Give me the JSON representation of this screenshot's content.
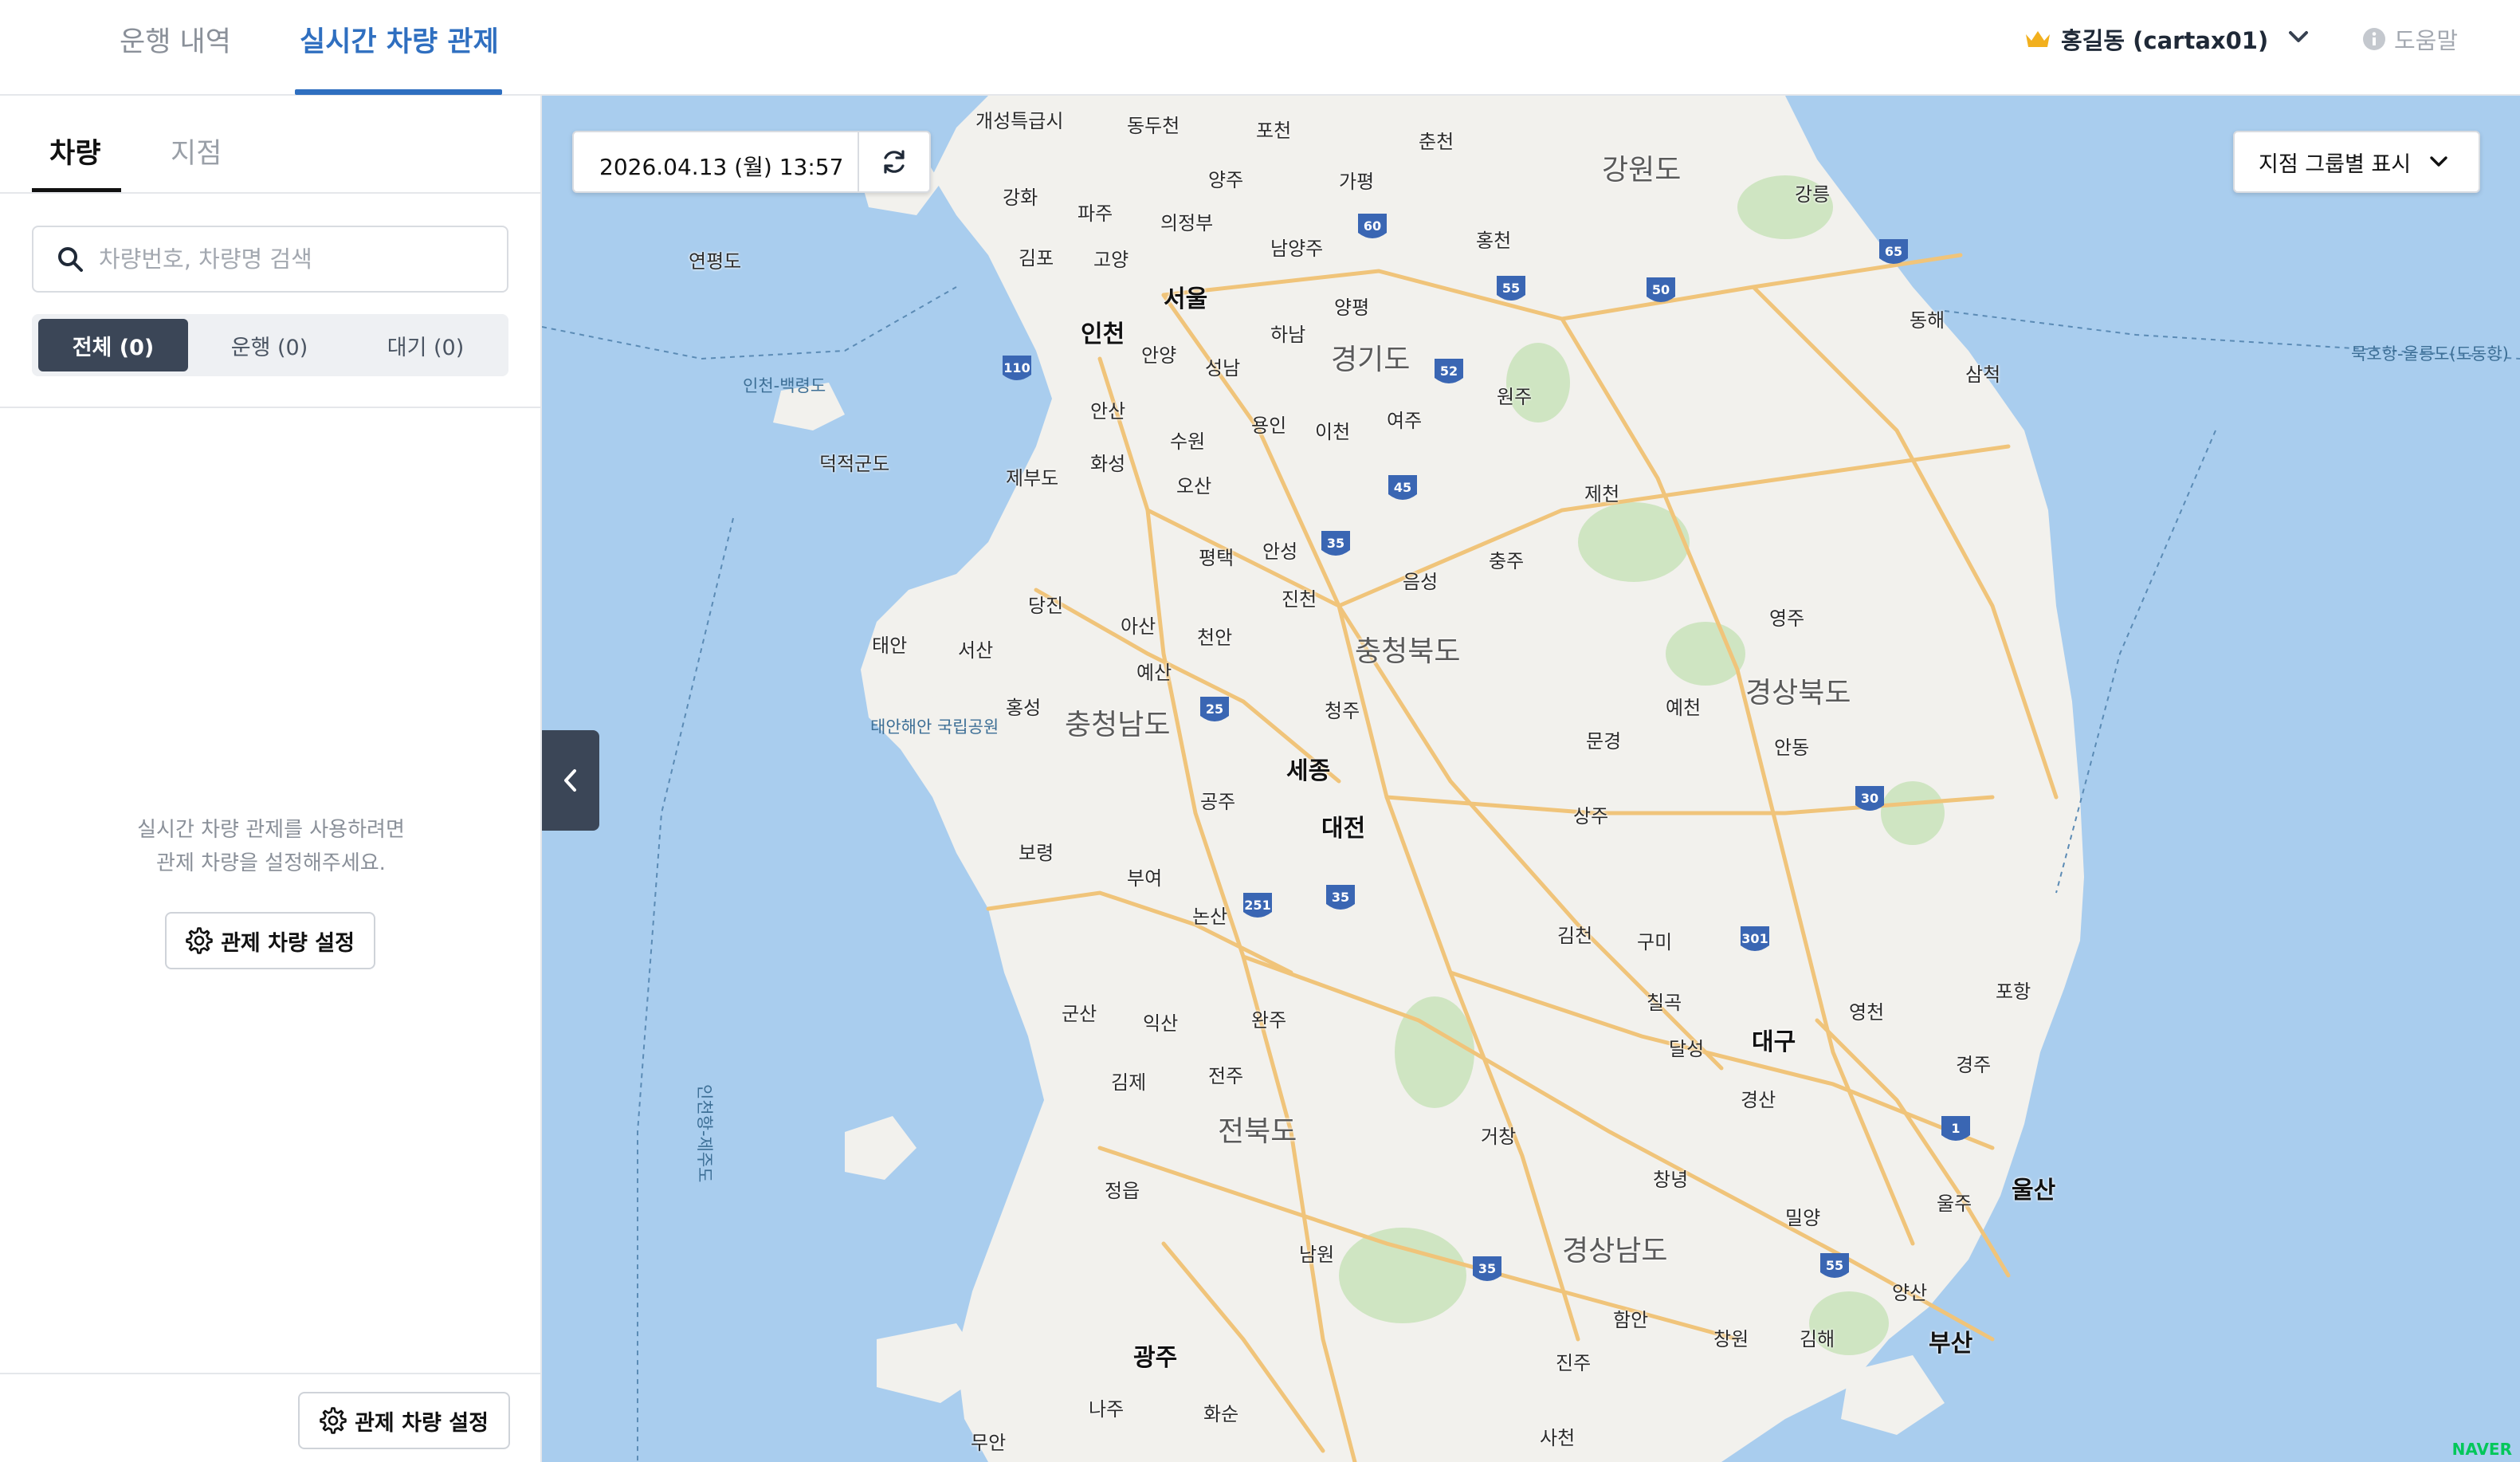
{
  "header": {
    "tabs": [
      {
        "label": "운행 내역",
        "active": false
      },
      {
        "label": "실시간 차량 관제",
        "active": true
      }
    ],
    "user": {
      "name": "홍길동 (cartax01)",
      "icon": "crown-icon"
    },
    "help_label": "도움말"
  },
  "sidebar": {
    "tabs": [
      {
        "label": "차량",
        "active": true
      },
      {
        "label": "지점",
        "active": false
      }
    ],
    "search": {
      "placeholder": "차량번호, 차량명 검색",
      "value": ""
    },
    "filters": [
      {
        "label": "전체 (0)",
        "active": true
      },
      {
        "label": "운행 (0)",
        "active": false
      },
      {
        "label": "대기 (0)",
        "active": false
      }
    ],
    "empty_message": "실시간 차량 관제를 사용하려면\n관제 차량을 설정해주세요.",
    "setup_button": "관제 차량 설정",
    "footer_setup_button": "관제 차량 설정"
  },
  "map": {
    "datetime": "2026.04.13 (월) 13:57",
    "group_select": "지점 그룹별 표시",
    "provinces": [
      "강원도",
      "경기도",
      "충청북도",
      "충청남도",
      "경상북도",
      "전북도",
      "경상남도"
    ],
    "major_cities": [
      "서울",
      "인천",
      "세종",
      "대전",
      "대구",
      "울산",
      "부산",
      "광주"
    ],
    "cities": [
      "개성특급시",
      "동두천",
      "포천",
      "춘천",
      "양주",
      "가평",
      "강화",
      "파주",
      "의정부",
      "남양주",
      "홍천",
      "강릉",
      "김포",
      "고양",
      "양평",
      "하남",
      "안양",
      "성남",
      "원주",
      "동해",
      "삼척",
      "안산",
      "수원",
      "용인",
      "이천",
      "여주",
      "제천",
      "화성",
      "오산",
      "평택",
      "안성",
      "음성",
      "충주",
      "진천",
      "당진",
      "아산",
      "천안",
      "영주",
      "태안",
      "서산",
      "예산",
      "홍성",
      "청주",
      "예천",
      "문경",
      "안동",
      "공주",
      "상주",
      "보령",
      "부여",
      "논산",
      "김천",
      "구미",
      "포항",
      "군산",
      "익산",
      "완주",
      "칠곡",
      "영천",
      "달성",
      "김제",
      "전주",
      "경주",
      "경산",
      "거창",
      "정읍",
      "창녕",
      "울주",
      "밀양",
      "남원",
      "양산",
      "함안",
      "창원",
      "김해",
      "진주",
      "나주",
      "화순",
      "무안",
      "사천",
      "연평도",
      "덕적군도",
      "제부도"
    ],
    "sea_labels": [
      "인천-백령도",
      "묵호항-울릉도(도동항)",
      "태안해안 국립공원",
      "인천항-제주도"
    ],
    "attribution": "NAVER"
  }
}
